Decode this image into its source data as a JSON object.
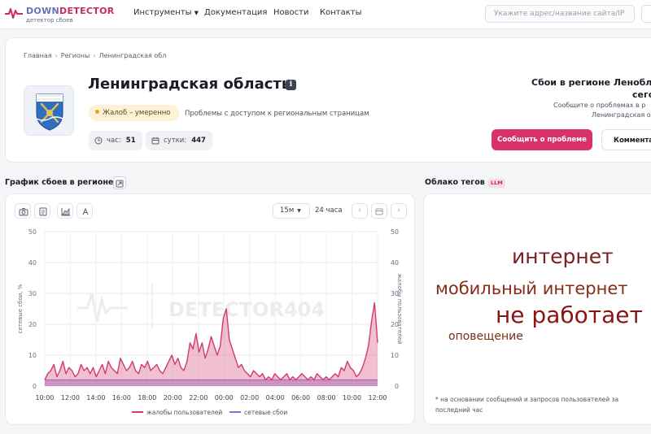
{
  "brand": {
    "name_part1": "DOWN",
    "name_part2": "DETECTOR",
    "tagline": "детектор сбоев",
    "accent": "#c62b5d"
  },
  "nav": {
    "tools": "Инструменты",
    "docs": "Документация",
    "news": "Новости",
    "contacts": "Контакты"
  },
  "search": {
    "placeholder": "Укажите адрес/название сайта/IP"
  },
  "breadcrumb": [
    "Главная",
    "Регионы",
    "Ленинградская обл"
  ],
  "region": {
    "title": "Ленинградская область",
    "status": "Жалоб – умеренно",
    "status_color": "#e6a11c",
    "status_desc": "Проблемы с доступом к региональным страницам",
    "hour_label": "час:",
    "hour_value": "51",
    "day_label": "сутки:",
    "day_value": "447"
  },
  "report_panel": {
    "title_line1": "Сбои в регионе Ленобл",
    "title_line2": "сего",
    "text_line1": "Сообщите о проблемах в р",
    "text_line2": "Ленинградская об",
    "report_button": "Сообщить о проблеме",
    "comment_button": "Комментар"
  },
  "chart_section": {
    "title": "График сбоев в регионе",
    "interval": "15м",
    "period": "24 часа",
    "watermark": "DETECTOR404"
  },
  "tags_section": {
    "title": "Облако тегов",
    "badge": "LLM",
    "tags": [
      {
        "text": "интернет",
        "color": "#7a1e1e"
      },
      {
        "text": "мобильный интернет",
        "color": "#8a2a17"
      },
      {
        "text": "не работает",
        "color": "#8a1414"
      },
      {
        "text": "оповещение",
        "color": "#7c2e14"
      }
    ],
    "footnote": "* на основании сообщений и запросов пользователей за последний час"
  },
  "chart_data": {
    "type": "area",
    "x_tick_labels": [
      "10:00",
      "12:00",
      "14:00",
      "16:00",
      "18:00",
      "20:00",
      "22:00",
      "00:00",
      "02:00",
      "04:00",
      "06:00",
      "08:00",
      "10:00",
      "12:00"
    ],
    "ylim": [
      0,
      50
    ],
    "y_ticks": [
      0,
      10,
      20,
      30,
      40,
      50
    ],
    "ylabel_left": "сетевые сбои, %",
    "ylabel_right": "жалобы пользователей",
    "legend": "bottom",
    "grid": true,
    "series": [
      {
        "name": "жалобы пользователей",
        "color": "#d23a6e",
        "values": [
          2,
          4,
          5,
          7,
          3,
          5,
          8,
          4,
          6,
          5,
          3,
          4,
          7,
          5,
          6,
          4,
          6,
          3,
          5,
          7,
          4,
          8,
          6,
          5,
          4,
          9,
          7,
          5,
          6,
          8,
          5,
          4,
          7,
          6,
          8,
          5,
          6,
          7,
          5,
          4,
          6,
          8,
          10,
          7,
          9,
          6,
          5,
          8,
          14,
          12,
          17,
          11,
          14,
          9,
          12,
          16,
          13,
          10,
          13,
          22,
          25,
          15,
          12,
          9,
          6,
          7,
          5,
          4,
          3,
          5,
          4,
          3,
          4,
          2,
          3,
          2,
          4,
          3,
          2,
          3,
          4,
          2,
          3,
          2,
          3,
          4,
          3,
          2,
          3,
          2,
          4,
          3,
          2,
          3,
          2,
          3,
          4,
          3,
          6,
          5,
          8,
          6,
          5,
          3,
          4,
          6,
          9,
          13,
          21,
          27,
          14
        ]
      },
      {
        "name": "сетевые сбои",
        "color": "#8b6fd6",
        "values": [
          2,
          2,
          2,
          2,
          2,
          2,
          2,
          2,
          2,
          2,
          2,
          2,
          2,
          2,
          2,
          2,
          2,
          2,
          2,
          2,
          2,
          2,
          2,
          2,
          2,
          2,
          2,
          2,
          2,
          2,
          2,
          2,
          2,
          2,
          2,
          2,
          2,
          2,
          2,
          2,
          2,
          2,
          2,
          2,
          2,
          2,
          2,
          2,
          2,
          2,
          2,
          2,
          2,
          2,
          2,
          2,
          2,
          2,
          2,
          2,
          2,
          2,
          2,
          2,
          2,
          2,
          2,
          2,
          2,
          2,
          2,
          2,
          2,
          2,
          2,
          2,
          2,
          2,
          2,
          2,
          2,
          2,
          2,
          2,
          2,
          2,
          2,
          2,
          2,
          2,
          2,
          2,
          2,
          2,
          2,
          2,
          2,
          2,
          2,
          2,
          2,
          2,
          2,
          2,
          2,
          2,
          2,
          2,
          2,
          2,
          2
        ]
      }
    ]
  }
}
